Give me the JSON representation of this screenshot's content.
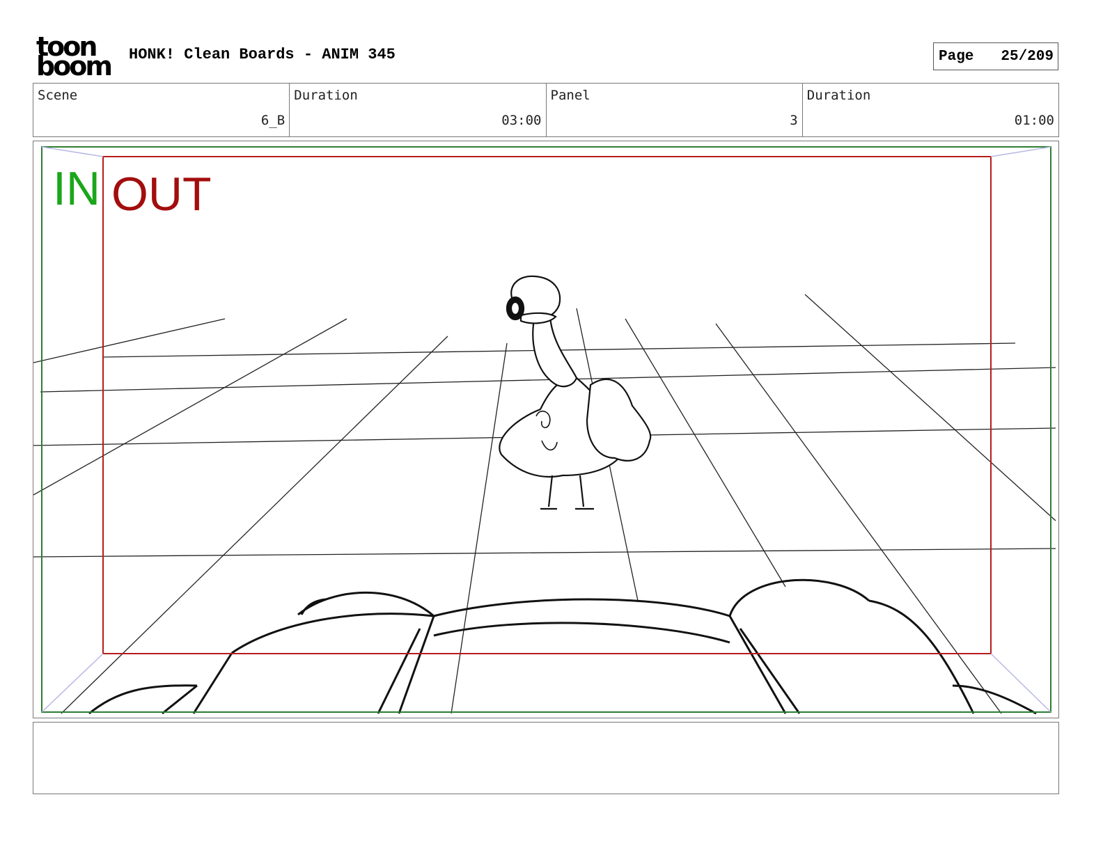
{
  "header": {
    "logo_text_top": "toon",
    "logo_text_bottom": "boom",
    "title": "HONK! Clean Boards - ANIM 345",
    "page_label": "Page",
    "page_value": "25/209"
  },
  "info": {
    "scene_label": "Scene",
    "scene_value": "6_B",
    "scene_duration_label": "Duration",
    "scene_duration_value": "03:00",
    "panel_label": "Panel",
    "panel_value": "3",
    "panel_duration_label": "Duration",
    "panel_duration_value": "01:00"
  },
  "frame": {
    "in_label": "IN",
    "out_label": "OUT",
    "in_color": "#1aa61a",
    "out_color": "#a30d0d",
    "safe_color": "#2e7d32"
  },
  "notes": {
    "text": ""
  }
}
